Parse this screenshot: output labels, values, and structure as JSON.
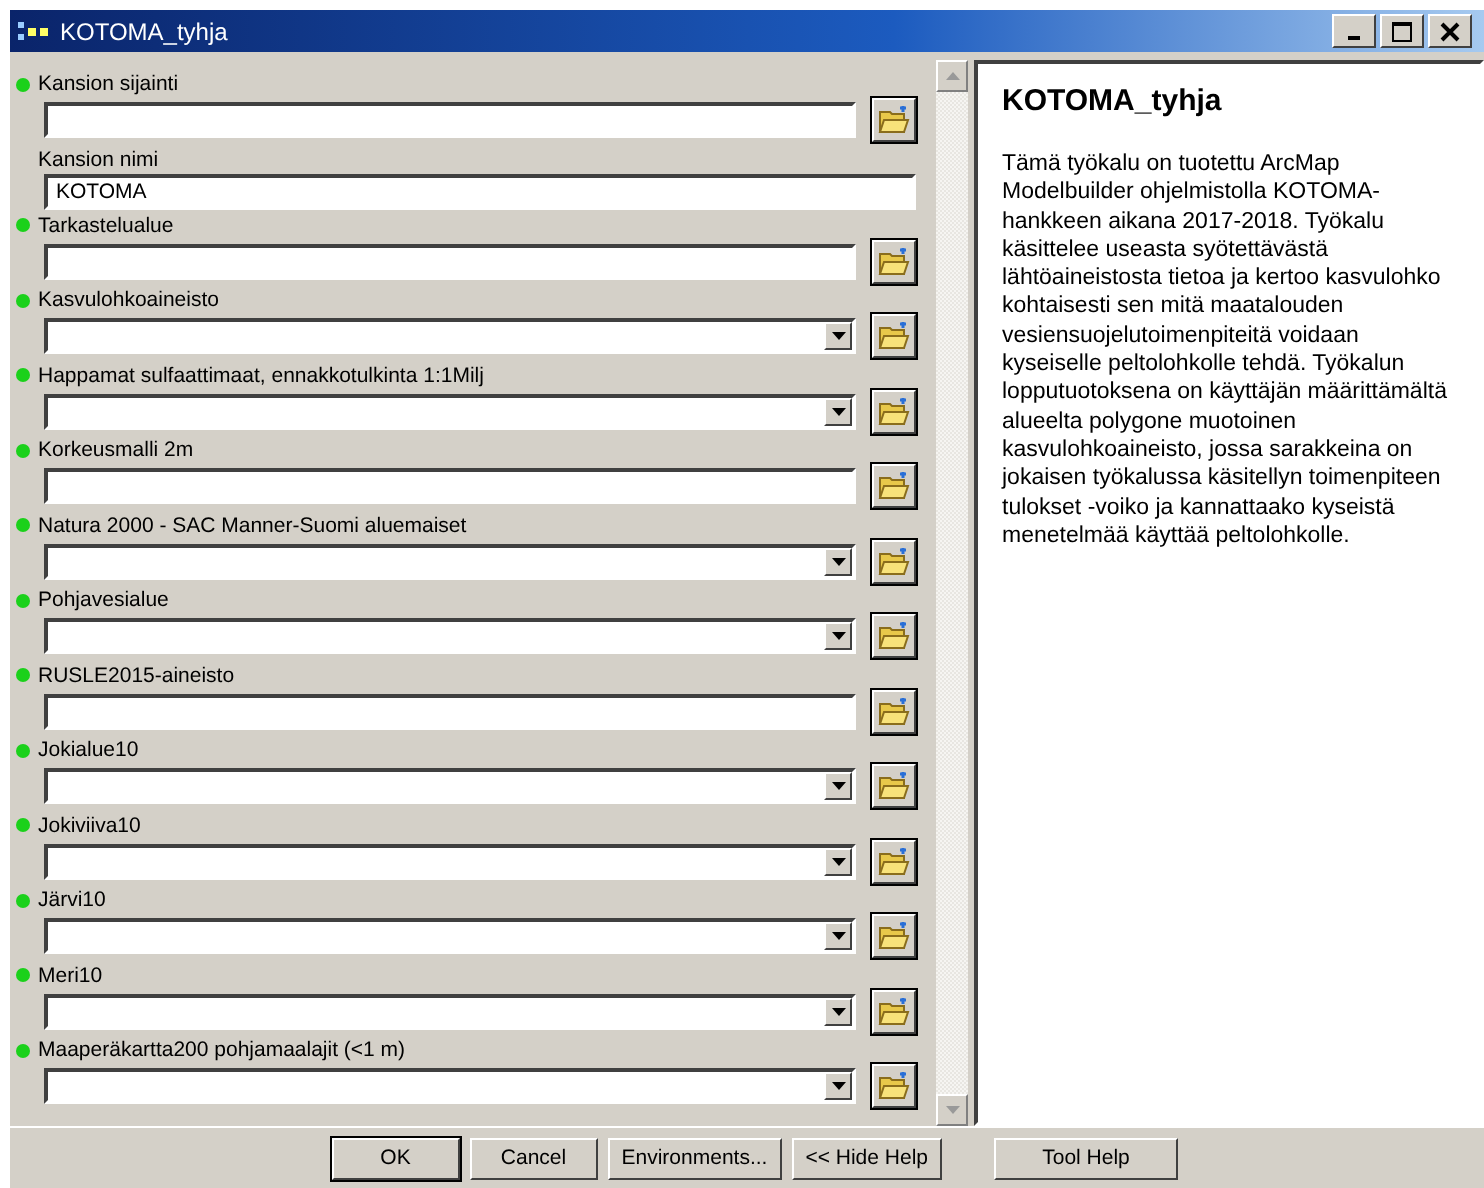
{
  "window": {
    "title": "KOTOMA_tyhja"
  },
  "parameters": [
    {
      "label": "Kansion sijainti",
      "kind": "text",
      "required": true,
      "browse": true
    },
    {
      "label": "Kansion nimi",
      "kind": "text",
      "required": false,
      "browse": false,
      "value": "KOTOMA"
    },
    {
      "label": "Tarkastelualue",
      "kind": "text",
      "required": true,
      "browse": true
    },
    {
      "label": "Kasvulohkoaineisto",
      "kind": "dropdown",
      "required": true,
      "browse": true
    },
    {
      "label": "Happamat sulfaattimaat, ennakkotulkinta 1:1Milj",
      "kind": "dropdown",
      "required": true,
      "browse": true
    },
    {
      "label": "Korkeusmalli 2m",
      "kind": "text",
      "required": true,
      "browse": true
    },
    {
      "label": "Natura 2000 - SAC Manner-Suomi aluemaiset",
      "kind": "dropdown",
      "required": true,
      "browse": true
    },
    {
      "label": "Pohjavesialue",
      "kind": "dropdown",
      "required": true,
      "browse": true
    },
    {
      "label": "RUSLE2015-aineisto",
      "kind": "text",
      "required": true,
      "browse": true
    },
    {
      "label": "Jokialue10",
      "kind": "dropdown",
      "required": true,
      "browse": true
    },
    {
      "label": "Jokiviiva10",
      "kind": "dropdown",
      "required": true,
      "browse": true
    },
    {
      "label": "Järvi10",
      "kind": "dropdown",
      "required": true,
      "browse": true
    },
    {
      "label": "Meri10",
      "kind": "dropdown",
      "required": true,
      "browse": true
    },
    {
      "label": "Maaperäkartta200 pohjamaalajit (<1 m)",
      "kind": "dropdown",
      "required": true,
      "browse": true
    }
  ],
  "help": {
    "title": "KOTOMA_tyhja",
    "text": "Tämä työkalu on tuotettu ArcMap Modelbuilder ohjelmistolla KOTOMA-hankkeen aikana 2017-2018. Työkalu käsittelee useasta syötettävästä lähtöaineistosta tietoa ja kertoo kasvulohko kohtaisesti sen mitä maatalouden vesiensuojelutoimenpiteitä voidaan kyseiselle peltolohkolle tehdä. Työkalun lopputuotoksena on käyttäjän määrittämältä alueelta polygone muotoinen kasvulohkoaineisto, jossa sarakkeina on jokaisen työkalussa käsitellyn toimenpiteen tulokset -voiko ja kannattaako kyseistä menetelmää käyttää peltolohkolle."
  },
  "buttons": [
    "OK",
    "Cancel",
    "Environments...",
    "<< Hide Help"
  ],
  "help_button": "Tool Help"
}
